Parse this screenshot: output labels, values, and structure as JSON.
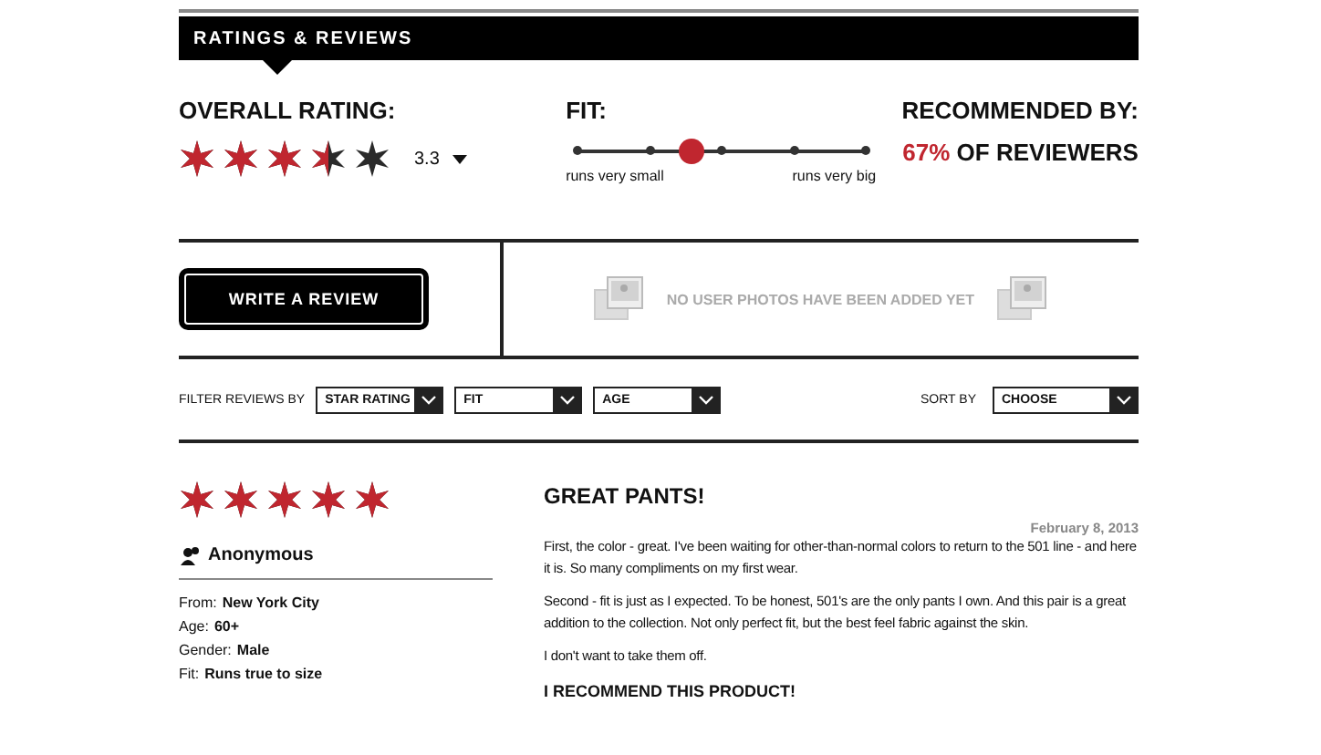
{
  "header": {
    "title": "RATINGS & REVIEWS"
  },
  "overall": {
    "label": "OVERALL RATING:",
    "stars": 3.5,
    "score": "3.3"
  },
  "fit": {
    "label": "FIT:",
    "level": 0.4,
    "min_label": "runs very small",
    "max_label": "runs very big"
  },
  "recommended": {
    "label": "RECOMMENDED BY:",
    "percent": "67%",
    "text": "OF REVIEWERS"
  },
  "write_button": "WRITE A REVIEW",
  "photos_message": "NO USER PHOTOS HAVE BEEN ADDED YET",
  "filter": {
    "label": "FILTER REVIEWS BY",
    "dropdowns": [
      "STAR RATING",
      "FIT",
      "AGE"
    ]
  },
  "sort": {
    "label": "SORT BY",
    "value": "CHOOSE"
  },
  "review": {
    "stars": 5,
    "author": "Anonymous",
    "details": [
      {
        "label": "From:",
        "value": "New York City"
      },
      {
        "label": "Age:",
        "value": "60+"
      },
      {
        "label": "Gender:",
        "value": "Male"
      },
      {
        "label": "Fit:",
        "value": "Runs true to size"
      }
    ],
    "title": "GREAT PANTS!",
    "date": "February 8, 2013",
    "paragraphs": [
      "First, the color - great. I've been waiting for other-than-normal colors to return to the 501 line - and here it is. So many compliments on my first wear.",
      "Second - fit is just as I expected. To be honest, 501's are the only pants I own. And this pair is a great addition to the collection. Not only perfect fit, but the best feel fabric against the skin.",
      "I don't want to take them off."
    ],
    "recommendation": "I RECOMMEND THIS PRODUCT!"
  }
}
